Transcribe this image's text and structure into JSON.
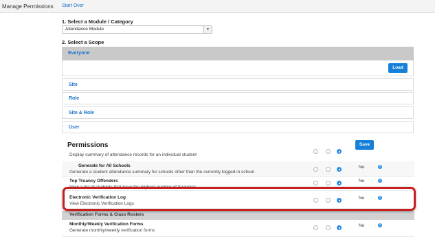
{
  "topbar": {
    "title": "Manage Permissions",
    "start_over": "Start Over"
  },
  "module": {
    "label": "1. Select a Module / Category",
    "selected": "Attendance Module"
  },
  "scope": {
    "label": "2. Select a Scope",
    "everyone": "Everyone",
    "load_button": "Load",
    "options": [
      "Site",
      "Role",
      "Site & Role",
      "User"
    ]
  },
  "permissions": {
    "title": "Permissions",
    "save_button": "Save",
    "cutoff_desc": "Display summary of attendance records for an individual student",
    "rows": [
      {
        "name": "Generate for All Schools",
        "desc": "Generate a student attendance summary for schools other than the currently logged in school",
        "value": "No"
      },
      {
        "name": "Top Truancy Offenders",
        "desc": "View a list of students that have the highest number of truancies",
        "value": "No"
      },
      {
        "name": "Electronic Verification Log",
        "desc": "View Electronic Verification Logs",
        "value": "No"
      }
    ],
    "category": "Verification Forms & Class Rosters",
    "rows2": [
      {
        "name": "Monthly/Weekly Verification Forms",
        "desc": "Generate monthly/weekly verification forms",
        "value": "No"
      }
    ],
    "info_glyph": "i"
  },
  "colors": {
    "accent": "#1680d8",
    "highlight": "#c71f1f"
  }
}
